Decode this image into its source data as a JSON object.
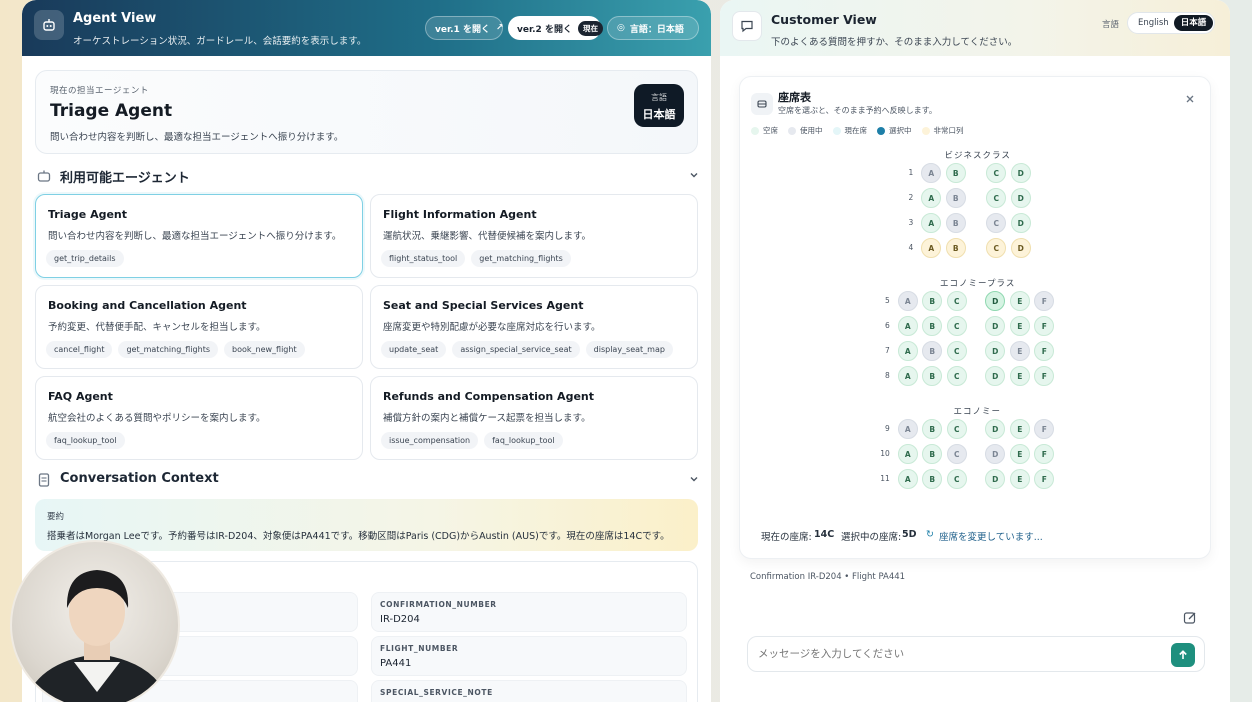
{
  "agent_view": {
    "title": "Agent View",
    "subtitle": "オーケストレーション状況、ガードレール、会話要約を表示します。",
    "btn_v1": "ver.1 を開く",
    "btn_v2": "ver.2 を開く",
    "btn_v2_badge": "現在",
    "lang_pill": "言語：日本語",
    "current": {
      "label": "現在の担当エージェント",
      "name": "Triage Agent",
      "desc": "問い合わせ内容を判断し、最適な担当エージェントへ振り分けます。",
      "lang_label": "言語",
      "lang_value": "日本語"
    },
    "agents_title": "利用可能エージェント",
    "agents": [
      {
        "name": "Triage Agent",
        "desc": "問い合わせ内容を判断し、最適な担当エージェントへ振り分けます。",
        "tools": [
          "get_trip_details"
        ]
      },
      {
        "name": "Flight Information Agent",
        "desc": "運航状況、乗継影響、代替便候補を案内します。",
        "tools": [
          "flight_status_tool",
          "get_matching_flights"
        ]
      },
      {
        "name": "Booking and Cancellation Agent",
        "desc": "予約変更、代替便手配、キャンセルを担当します。",
        "tools": [
          "cancel_flight",
          "get_matching_flights",
          "book_new_flight"
        ]
      },
      {
        "name": "Seat and Special Services Agent",
        "desc": "座席変更や特別配慮が必要な座席対応を行います。",
        "tools": [
          "update_seat",
          "assign_special_service_seat",
          "display_seat_map"
        ]
      },
      {
        "name": "FAQ Agent",
        "desc": "航空会社のよくある質問やポリシーを案内します。",
        "tools": [
          "faq_lookup_tool"
        ]
      },
      {
        "name": "Refunds and Compensation Agent",
        "desc": "補償方針の案内と補償ケース起票を担当します。",
        "tools": [
          "issue_compensation",
          "faq_lookup_tool"
        ]
      }
    ],
    "context_title": "Conversation Context",
    "summary_label": "要約",
    "summary_text": "搭乗者はMorgan Leeです。予約番号はIR-D204、対象便はPA441です。移動区間はParis (CDG)からAustin (AUS)です。現在の座席は14Cです。",
    "fields": [
      {
        "label": "CONFIRMATION_NUMBER",
        "value": "IR-D204"
      },
      {
        "label": "FLIGHT_NUMBER",
        "value": "PA441"
      },
      {
        "label": "SPECIAL_SERVICE_NOTE",
        "value": ""
      }
    ]
  },
  "customer_view": {
    "title": "Customer View",
    "subtitle": "下のよくある質問を押すか、そのまま入力してください。",
    "lang_label": "言語",
    "lang_en": "English",
    "lang_ja": "日本語",
    "seat_map": {
      "title": "座席表",
      "subtitle": "空席を選ぶと、そのまま予約へ反映します。",
      "legend": [
        {
          "label": "空席",
          "color": "#e6f6ee"
        },
        {
          "label": "使用中",
          "color": "#e6e9ef"
        },
        {
          "label": "現在席",
          "color": "#e4f6f8"
        },
        {
          "label": "選択中",
          "color": "#1e7fa8"
        },
        {
          "label": "非常口列",
          "color": "#fdf3d9"
        }
      ],
      "cabins": [
        {
          "name": "ビジネスクラス",
          "left": [
            "A",
            "B"
          ],
          "right": [
            "C",
            "D"
          ],
          "rows": [
            {
              "n": "1",
              "states": [
                "occ",
                "avail",
                "avail",
                "avail"
              ]
            },
            {
              "n": "2",
              "states": [
                "avail",
                "occ",
                "avail",
                "avail"
              ]
            },
            {
              "n": "3",
              "states": [
                "avail",
                "occ",
                "occ",
                "avail"
              ]
            },
            {
              "n": "4",
              "states": [
                "exit",
                "exit",
                "exit",
                "exit"
              ]
            }
          ]
        },
        {
          "name": "エコノミープラス",
          "left": [
            "A",
            "B",
            "C"
          ],
          "right": [
            "D",
            "E",
            "F"
          ],
          "rows": [
            {
              "n": "5",
              "states": [
                "occ",
                "avail",
                "avail",
                "sel",
                "avail",
                "occ"
              ]
            },
            {
              "n": "6",
              "states": [
                "avail",
                "avail",
                "avail",
                "avail",
                "avail",
                "avail"
              ]
            },
            {
              "n": "7",
              "states": [
                "avail",
                "occ",
                "avail",
                "avail",
                "occ",
                "avail"
              ]
            },
            {
              "n": "8",
              "states": [
                "avail",
                "avail",
                "avail",
                "avail",
                "avail",
                "avail"
              ]
            }
          ]
        },
        {
          "name": "エコノミー",
          "left": [
            "A",
            "B",
            "C"
          ],
          "right": [
            "D",
            "E",
            "F"
          ],
          "rows": [
            {
              "n": "9",
              "states": [
                "occ",
                "avail",
                "avail",
                "avail",
                "avail",
                "occ"
              ]
            },
            {
              "n": "10",
              "states": [
                "avail",
                "avail",
                "occ",
                "occ",
                "avail",
                "avail"
              ]
            },
            {
              "n": "11",
              "states": [
                "avail",
                "avail",
                "avail",
                "avail",
                "avail",
                "avail"
              ]
            }
          ]
        }
      ],
      "current_seat_label": "現在の座席:",
      "current_seat": "14C",
      "selected_seat_label": "選択中の座席:",
      "selected_seat": "5D",
      "status": "座席を変更しています..."
    },
    "confirmation": "Confirmation IR-D204 • Flight PA441",
    "input_placeholder": "メッセージを入力してください"
  }
}
